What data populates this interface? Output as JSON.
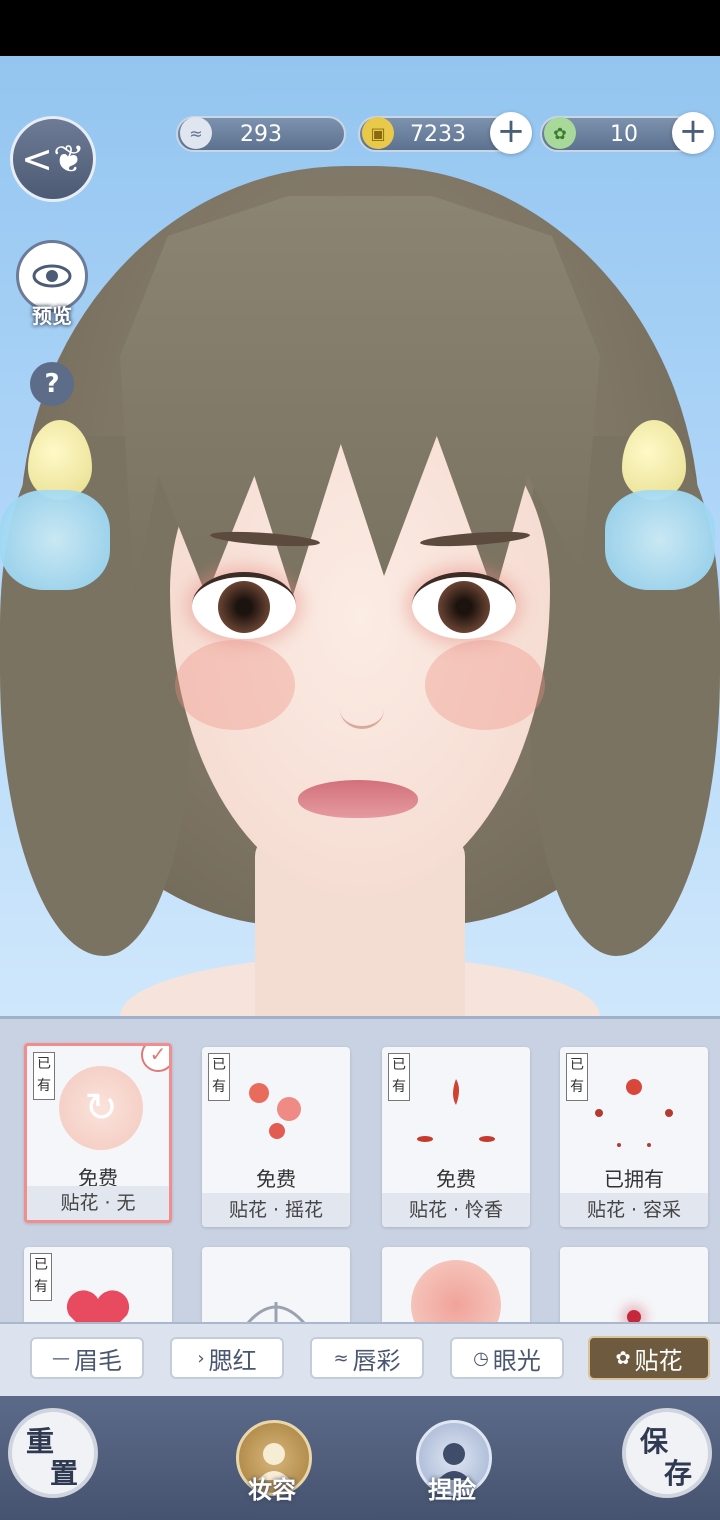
{
  "currency": {
    "silver": "293",
    "coins": "7233",
    "jade": "10"
  },
  "side_buttons": {
    "preview_label": "预览",
    "help_label": "?"
  },
  "items_row1": [
    {
      "owned": "已有",
      "price": "免费",
      "name": "贴花 · 无",
      "selected": true
    },
    {
      "owned": "已有",
      "price": "免费",
      "name": "贴花 · 摇花"
    },
    {
      "owned": "已有",
      "price": "免费",
      "name": "贴花 · 怜香"
    },
    {
      "owned": "已有",
      "price": "已拥有",
      "name": "贴花 · 容采"
    }
  ],
  "items_row2": [
    {
      "owned": "已有"
    },
    {},
    {},
    {}
  ],
  "tabs": [
    {
      "label": "眉毛",
      "icon": "brow-icon"
    },
    {
      "label": "腮红",
      "icon": "blush-icon"
    },
    {
      "label": "唇彩",
      "icon": "lips-icon"
    },
    {
      "label": "眼光",
      "icon": "eye-light-icon"
    },
    {
      "label": "贴花",
      "icon": "decal-icon",
      "active": true
    }
  ],
  "bottom": {
    "reset": [
      "重",
      "置"
    ],
    "makeup": "妆容",
    "face_shape": "捏脸",
    "save": [
      "保",
      "存"
    ]
  },
  "colors": {
    "accent_active_tab": "#6e5a3e",
    "selected_border": "#f08e8e",
    "bottom_bar": "#4f5c7a"
  }
}
